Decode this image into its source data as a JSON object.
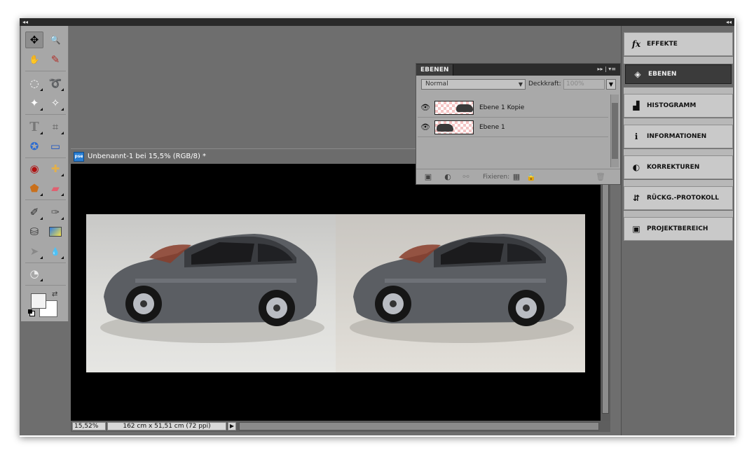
{
  "app": {
    "collapse_left": "◂◂",
    "collapse_right": "◂◂"
  },
  "toolbox": {
    "tools": [
      {
        "name": "move-tool-icon",
        "glyph": "✥"
      },
      {
        "name": "zoom-tool-icon",
        "glyph": "🔍"
      },
      {
        "name": "hand-tool-icon",
        "glyph": "✋"
      },
      {
        "name": "eyedropper-tool-icon",
        "glyph": "✎"
      },
      {
        "name": "marquee-tool-icon",
        "glyph": "◌"
      },
      {
        "name": "lasso-tool-icon",
        "glyph": "➰"
      },
      {
        "name": "magic-wand-tool-icon",
        "glyph": "✦"
      },
      {
        "name": "quick-selection-tool-icon",
        "glyph": "✧"
      },
      {
        "name": "type-tool-icon",
        "glyph": "T"
      },
      {
        "name": "crop-tool-icon",
        "glyph": "⌗"
      },
      {
        "name": "cookie-cutter-tool-icon",
        "glyph": "✪"
      },
      {
        "name": "recompose-tool-icon",
        "glyph": "▭"
      },
      {
        "name": "red-eye-tool-icon",
        "glyph": "◉"
      },
      {
        "name": "healing-brush-tool-icon",
        "glyph": "✚"
      },
      {
        "name": "clone-stamp-tool-icon",
        "glyph": "⬟"
      },
      {
        "name": "eraser-tool-icon",
        "glyph": "▰"
      },
      {
        "name": "brush-tool-icon",
        "glyph": "✐"
      },
      {
        "name": "smart-brush-tool-icon",
        "glyph": "✑"
      },
      {
        "name": "paint-bucket-tool-icon",
        "glyph": "⛁"
      },
      {
        "name": "gradient-tool-icon",
        "glyph": "▤"
      },
      {
        "name": "custom-shape-tool-icon",
        "glyph": "➤"
      },
      {
        "name": "blur-tool-icon",
        "glyph": "💧"
      },
      {
        "name": "sponge-tool-icon",
        "glyph": "◔"
      }
    ]
  },
  "document": {
    "badge": "pse",
    "title": "Unbenannt-1 bei 15,5% (RGB/8) *",
    "zoom": "15,52%",
    "dimensions": "162 cm x 51,51 cm (72 ppi)",
    "status_arrow": "▶"
  },
  "layers_panel": {
    "title": "EBENEN",
    "menu": "▸▸ | ▾≡",
    "blend_mode": "Normal",
    "opacity_label": "Deckkraft:",
    "opacity_value": "100%",
    "rows": [
      {
        "name": "Ebene 1 Kopie",
        "eye": "👁"
      },
      {
        "name": "Ebene 1",
        "eye": "👁"
      }
    ],
    "lock_label": "Fixieren:"
  },
  "dock": {
    "items": [
      {
        "label": "EFFEKTE",
        "icon": "fx"
      },
      {
        "label": "EBENEN",
        "icon": "◈"
      },
      {
        "label": "HISTOGRAMM",
        "icon": "▟"
      },
      {
        "label": "INFORMATIONEN",
        "icon": "ℹ"
      },
      {
        "label": "KORREKTUREN",
        "icon": "◐"
      },
      {
        "label": "RÜCKG.-PROTOKOLL",
        "icon": "⇵"
      },
      {
        "label": "PROJEKTBEREICH",
        "icon": "▣"
      }
    ]
  }
}
